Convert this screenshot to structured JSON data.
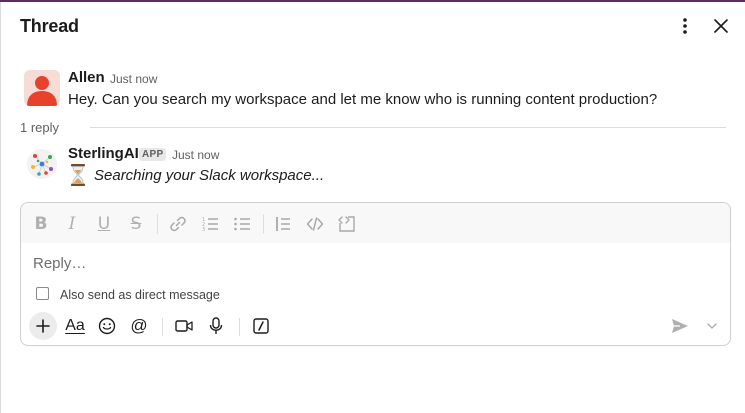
{
  "header": {
    "title": "Thread",
    "more_icon": "more-vertical-icon",
    "close_icon": "close-icon"
  },
  "messages": [
    {
      "author": "Allen",
      "time": "Just now",
      "text": "Hey. Can you search my workspace and let me know who is running content production?",
      "avatar_icon": "user-avatar",
      "avatar_color": "#e8412c"
    },
    {
      "author": "SterlingAI",
      "badge": "APP",
      "time": "Just now",
      "status_icon": "hourglass-icon",
      "text": "Searching your Slack workspace..."
    }
  ],
  "thread": {
    "reply_count": "1 reply"
  },
  "composer": {
    "placeholder": "Reply…",
    "also_send_dm_label": "Also send as direct message",
    "formatting": [
      "bold",
      "italic",
      "underline",
      "strikethrough",
      "link",
      "ordered-list",
      "bulleted-list",
      "blockquote",
      "code",
      "code-block"
    ],
    "actions": [
      "plus",
      "formatting-aa",
      "emoji",
      "mention",
      "video",
      "microphone",
      "slash-command",
      "send",
      "send-options"
    ]
  },
  "colors": {
    "accent": "#5b2c5f",
    "send_icon": "#b0b0b0"
  }
}
